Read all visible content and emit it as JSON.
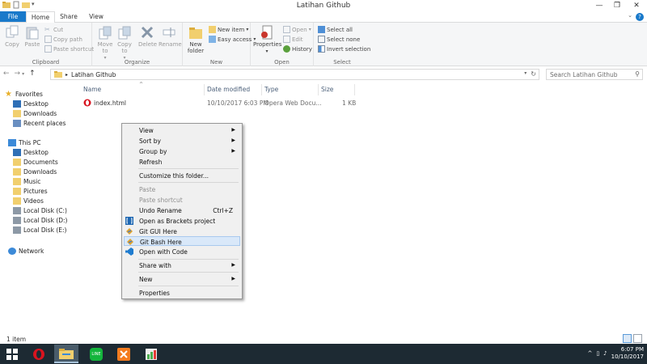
{
  "window": {
    "title": "Latihan Github"
  },
  "ribbon_tabs": [
    "File",
    "Home",
    "Share",
    "View"
  ],
  "ribbon": {
    "clipboard": {
      "label": "Clipboard",
      "copy": "Copy",
      "paste": "Paste",
      "cut": "Cut",
      "copy_path": "Copy path",
      "paste_shortcut": "Paste shortcut"
    },
    "organize": {
      "label": "Organize",
      "move_to": "Move to",
      "copy_to": "Copy to",
      "delete": "Delete",
      "rename": "Rename"
    },
    "new": {
      "label": "New",
      "new_folder": "New folder",
      "new_item": "New item",
      "easy_access": "Easy access"
    },
    "open": {
      "label": "Open",
      "properties": "Properties",
      "open": "Open",
      "edit": "Edit",
      "history": "History"
    },
    "select": {
      "label": "Select",
      "select_all": "Select all",
      "select_none": "Select none",
      "invert_selection": "Invert selection"
    }
  },
  "address": {
    "path": "Latihan Github",
    "search_placeholder": "Search Latihan Github"
  },
  "nav_pane": {
    "favorites": "Favorites",
    "favorites_items": [
      "Desktop",
      "Downloads",
      "Recent places"
    ],
    "this_pc": "This PC",
    "this_pc_items": [
      "Desktop",
      "Documents",
      "Downloads",
      "Music",
      "Pictures",
      "Videos",
      "Local Disk (C:)",
      "Local Disk (D:)",
      "Local Disk (E:)"
    ],
    "network": "Network"
  },
  "columns": [
    "Name",
    "Date modified",
    "Type",
    "Size"
  ],
  "files": [
    {
      "name": "index.html",
      "date": "10/10/2017 6:03 PM",
      "type": "Opera Web Docu...",
      "size": "1 KB"
    }
  ],
  "context_menu": {
    "view": "View",
    "sort_by": "Sort by",
    "group_by": "Group by",
    "refresh": "Refresh",
    "customize": "Customize this folder...",
    "paste": "Paste",
    "paste_shortcut": "Paste shortcut",
    "undo_rename": "Undo Rename",
    "undo_shortcut": "Ctrl+Z",
    "open_brackets": "Open as Brackets project",
    "git_gui": "Git GUI Here",
    "git_bash": "Git Bash Here",
    "open_code": "Open with Code",
    "share_with": "Share with",
    "new": "New",
    "properties": "Properties"
  },
  "status": {
    "item_count": "1 item"
  },
  "taskbar": {
    "time": "6:07 PM",
    "date": "10/10/2017",
    "line_label": "LINE"
  },
  "colors": {
    "file_tab": "#1979ca",
    "highlight": "#d9e8f9",
    "taskbar": "#1d2a33"
  }
}
